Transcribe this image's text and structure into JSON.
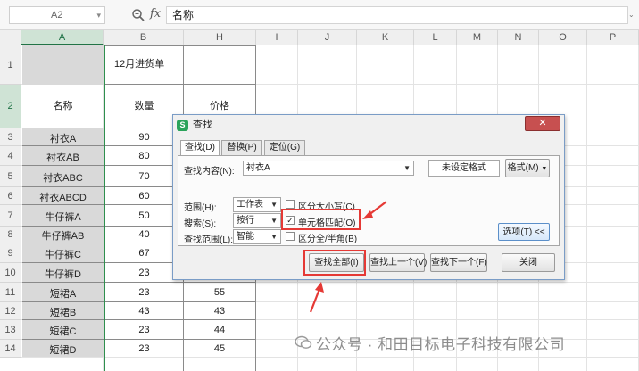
{
  "formula_bar": {
    "name_box": "A2",
    "fx": "fx",
    "content": "名称"
  },
  "columns": [
    "A",
    "B",
    "H",
    "I",
    "J",
    "K",
    "L",
    "M",
    "N",
    "O",
    "P"
  ],
  "rows": [
    "1",
    "2",
    "3",
    "4",
    "5",
    "6",
    "7",
    "8",
    "9",
    "10",
    "11",
    "12",
    "13",
    "14"
  ],
  "sheet": {
    "title": "12月进货单",
    "header_name": "名称",
    "header_qty": "数量",
    "header_price": "价格",
    "items": [
      {
        "name": "衬衣A",
        "qty": "90",
        "price": ""
      },
      {
        "name": "衬衣AB",
        "qty": "80",
        "price": ""
      },
      {
        "name": "衬衣ABC",
        "qty": "70",
        "price": ""
      },
      {
        "name": "衬衣ABCD",
        "qty": "60",
        "price": ""
      },
      {
        "name": "牛仔裤A",
        "qty": "50",
        "price": ""
      },
      {
        "name": "牛仔裤AB",
        "qty": "40",
        "price": ""
      },
      {
        "name": "牛仔裤C",
        "qty": "67",
        "price": ""
      },
      {
        "name": "牛仔裤D",
        "qty": "23",
        "price": ""
      },
      {
        "name": "短裙A",
        "qty": "23",
        "price": "55"
      },
      {
        "name": "短裙B",
        "qty": "43",
        "price": "43"
      },
      {
        "name": "短裙C",
        "qty": "23",
        "price": "44"
      },
      {
        "name": "短裙D",
        "qty": "23",
        "price": "45"
      }
    ]
  },
  "dialog": {
    "title": "查找",
    "tabs": [
      "查找(D)",
      "替换(P)",
      "定位(G)"
    ],
    "find_label": "查找内容(N):",
    "find_value": "衬衣A",
    "format_status": "未设定格式",
    "format_button": "格式(M)",
    "scope_label": "范围(H):",
    "scope_value": "工作表",
    "search_label": "搜索(S):",
    "search_value": "按行",
    "lookin_label": "查找范围(L):",
    "lookin_value": "智能",
    "match_case": "区分大小写(C)",
    "match_cell": "单元格匹配(O)",
    "match_width": "区分全/半角(B)",
    "options_button": "选项(T) <<",
    "find_all": "查找全部(I)",
    "find_prev": "查找上一个(V)",
    "find_next": "查找下一个(F)",
    "close": "关闭"
  },
  "watermark": "公众号 · 和田目标电子科技有限公司",
  "colors": {
    "accent": "#217346",
    "highlight": "#e53935",
    "watermark": "#8d8d8d"
  }
}
